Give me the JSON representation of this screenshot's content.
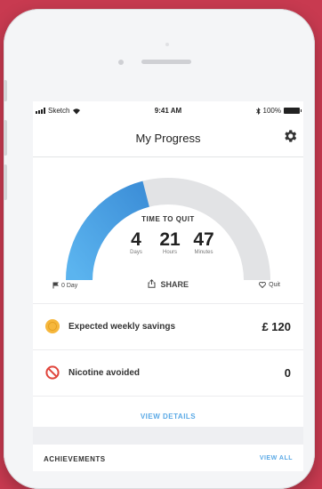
{
  "status_bar": {
    "carrier": "Sketch",
    "time": "9:41 AM",
    "battery": "100%"
  },
  "nav": {
    "title": "My Progress",
    "settings_icon": "gear-icon"
  },
  "progress": {
    "label": "TIME TO QUIT",
    "fraction_complete": 0.42,
    "days": "4",
    "days_unit": "Days",
    "hours": "21",
    "hours_unit": "Hours",
    "minutes": "47",
    "minutes_unit": "Minutes",
    "start_label": "0 Day",
    "share_label": "SHARE",
    "end_label": "Quit",
    "colors": {
      "fill_start": "#5bb4ef",
      "fill_end": "#3d8fd8",
      "track": "#e2e3e5"
    }
  },
  "stats": [
    {
      "icon": "coin-icon",
      "label": "Expected weekly savings",
      "value": "£ 120",
      "color": "#f6b73c"
    },
    {
      "icon": "no-smoking-icon",
      "label": "Nicotine avoided",
      "value": "0",
      "color": "#e0443b"
    }
  ],
  "details_link": "VIEW DETAILS",
  "achievements": {
    "title": "ACHIEVEMENTS",
    "view_all": "VIEW ALL"
  }
}
